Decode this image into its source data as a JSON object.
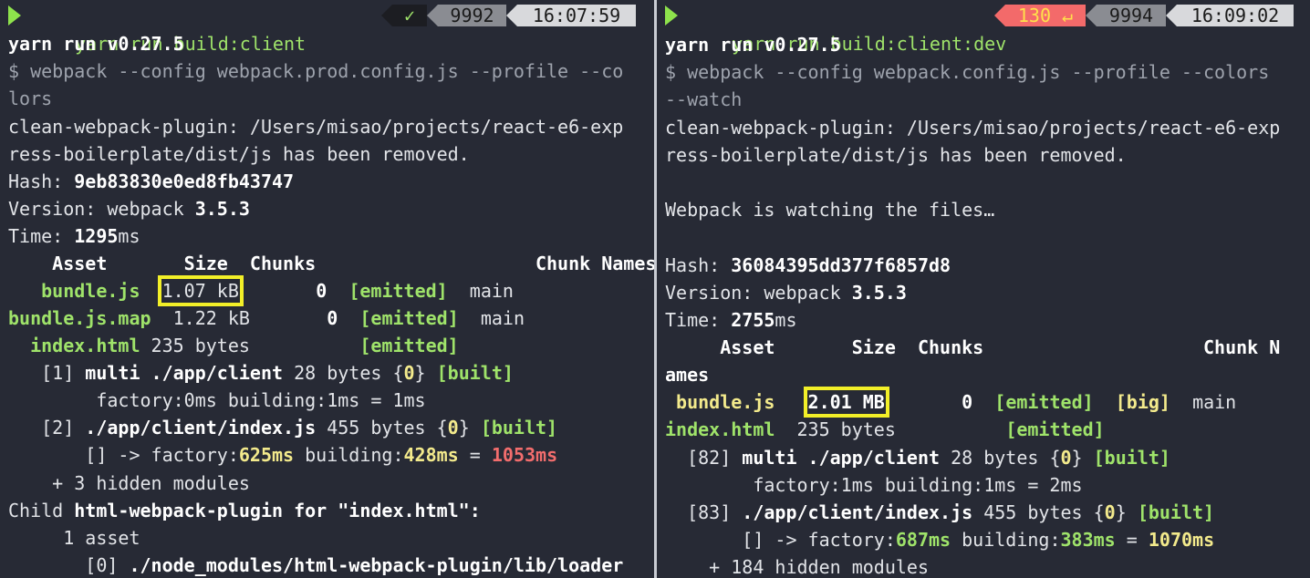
{
  "left": {
    "command": "yarn run build:client",
    "status_icon": "✓",
    "history_num": "9992",
    "time": "16:07:59",
    "lines": {
      "l1": "yarn run v0.27.5",
      "l2": "$ webpack --config webpack.prod.config.js --profile --co",
      "l3": "lors",
      "l4": "clean-webpack-plugin: /Users/misao/projects/react-e6-exp",
      "l5": "ress-boilerplate/dist/js has been removed.",
      "hash_label": "Hash: ",
      "hash": "9eb83830e0ed8fb43747",
      "version_label": "Version: webpack ",
      "version": "3.5.3",
      "time_label": "Time: ",
      "time_val": "1295",
      "time_unit": "ms",
      "header": "    Asset       Size  Chunks                    Chunk Names",
      "r1_asset": "   bundle.js",
      "r1_size": "1.07 kB",
      "r1_chunk": "0",
      "r1_flag": "[emitted]",
      "r1_name": "main",
      "r2_asset": "bundle.js.map",
      "r2_size": "1.22 kB",
      "r2_chunk": "0",
      "r2_flag": "[emitted]",
      "r2_name": "main",
      "r3_asset": "  index.html",
      "r3_size": "235 bytes",
      "r3_flag": "[emitted]",
      "m1_pre": "   [1] ",
      "m1_mod": "multi ./app/client",
      "m1_size": " 28 bytes {",
      "m1_chunk": "0",
      "m1_close": "} ",
      "m1_built": "[built]",
      "m1_factory": "        factory:0ms building:1ms = 1ms",
      "m2_pre": "   [2] ",
      "m2_mod": "./app/client/index.js",
      "m2_size": " 455 bytes {",
      "m2_chunk": "0",
      "m2_close": "} ",
      "m2_built": "[built]",
      "m2_f_pre": "       [] -> factory:",
      "m2_f_val": "625ms",
      "m2_b_pre": " building:",
      "m2_b_val": "428ms",
      "m2_eq": " = ",
      "m2_total": "1053ms",
      "hidden": "    + 3 hidden modules",
      "child_pre": "Child ",
      "child_name": "html-webpack-plugin for \"index.html\":",
      "asset_count": "     1 asset",
      "loader_pre": "       [0] ",
      "loader_mod": "./node_modules/html-webpack-plugin/lib/loader"
    }
  },
  "right": {
    "command": "yarn run build:client:dev",
    "exit_code": "130 ↵",
    "history_num": "9994",
    "time": "16:09:02",
    "lines": {
      "l1": "yarn run v0.27.5",
      "l2": "$ webpack --config webpack.config.js --profile --colors",
      "l3": "--watch",
      "l4": "clean-webpack-plugin: /Users/misao/projects/react-e6-exp",
      "l5": "ress-boilerplate/dist/js has been removed.",
      "watching": "Webpack is watching the files…",
      "hash_label": "Hash: ",
      "hash": "36084395dd377f6857d8",
      "version_label": "Version: webpack ",
      "version": "3.5.3",
      "time_label": "Time: ",
      "time_val": "2755",
      "time_unit": "ms",
      "header": "     Asset       Size  Chunks                    Chunk N",
      "header_wrap": "ames",
      "r1_asset": " bundle.js",
      "r1_size": "2.01 MB",
      "r1_chunk": "0",
      "r1_flag": "[emitted]",
      "r1_big": "[big]",
      "r1_name": "main",
      "r2_asset": "index.html",
      "r2_size": "235 bytes",
      "r2_flag": "[emitted]",
      "m1_pre": "  [82] ",
      "m1_mod": "multi ./app/client",
      "m1_size": " 28 bytes {",
      "m1_chunk": "0",
      "m1_close": "} ",
      "m1_built": "[built]",
      "m1_factory": "        factory:1ms building:1ms = 2ms",
      "m2_pre": "  [83] ",
      "m2_mod": "./app/client/index.js",
      "m2_size": " 455 bytes {",
      "m2_chunk": "0",
      "m2_close": "} ",
      "m2_built": "[built]",
      "m2_f_pre": "       [] -> factory:",
      "m2_f_val": "687ms",
      "m2_b_pre": " building:",
      "m2_b_val": "383ms",
      "m2_eq": " = ",
      "m2_total": "1070ms",
      "hidden": "    + 184 hidden modules"
    }
  },
  "colors": {
    "background": "#272a35",
    "prompt_arrow": "#8ee24c",
    "green": "#9fe36a",
    "yellow": "#f3ea8c",
    "red": "#f26d6d",
    "highlight_box": "#f2ef28"
  }
}
